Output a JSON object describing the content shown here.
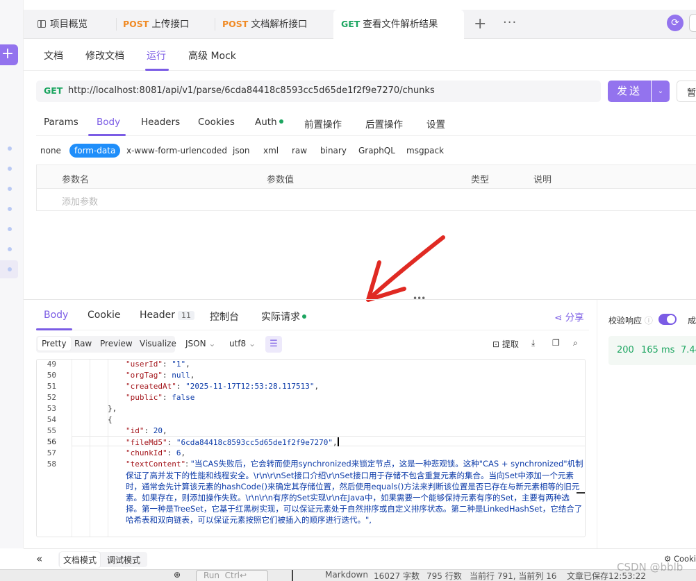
{
  "tabs": {
    "overview": "项目概览",
    "upload": {
      "method": "POST",
      "label": "上传接口"
    },
    "parse": {
      "method": "POST",
      "label": "文档解析接口"
    },
    "result": {
      "method": "GET",
      "label": "查看文件解析结果"
    }
  },
  "subtabs": [
    "文档",
    "修改文档",
    "运行",
    "高级 Mock"
  ],
  "request": {
    "method": "GET",
    "url": "http://localhost:8081/api/v1/parse/6cda84418c8593cc5d65de1f2f9e7270/chunks",
    "send_label": "发送",
    "save_label": "暂"
  },
  "param_tabs": [
    "Params",
    "Body",
    "Headers",
    "Cookies",
    "Auth",
    "前置操作",
    "后置操作",
    "设置"
  ],
  "body_types": [
    "none",
    "form-data",
    "x-www-form-urlencoded",
    "json",
    "xml",
    "raw",
    "binary",
    "GraphQL",
    "msgpack"
  ],
  "param_table": {
    "headers": [
      "参数名",
      "参数值",
      "类型",
      "说明"
    ],
    "add_placeholder": "添加参数"
  },
  "response": {
    "tabs": [
      "Body",
      "Cookie",
      "Header",
      "控制台",
      "实际请求"
    ],
    "header_count": "11",
    "share": "分享",
    "views": [
      "Pretty",
      "Raw",
      "Preview",
      "Visualize"
    ],
    "format": "JSON",
    "encoding": "utf8",
    "extract": "提取",
    "validate_label": "校验响应",
    "validate_cut": "成",
    "status": "200",
    "time": "165 ms",
    "size": "7.44"
  },
  "code": {
    "line_numbers": [
      "49",
      "50",
      "51",
      "52",
      "53",
      "54",
      "55",
      "56",
      "57",
      "58"
    ],
    "l49k": "\"userId\"",
    "l49v": "\"1\"",
    "l50k": "\"orgTag\"",
    "l50v": "null",
    "l51k": "\"createdAt\"",
    "l51v": "\"2025-11-17T12:53:28.117513\"",
    "l52k": "\"public\"",
    "l52v": "false",
    "l53": "},",
    "l54": "{",
    "l55k": "\"id\"",
    "l55v": "20",
    "l56k": "\"fileMd5\"",
    "l56v": "\"6cda84418c8593cc5d65de1f2f9e7270\"",
    "l57k": "\"chunkId\"",
    "l57v": "6",
    "l58k": "\"textContent\"",
    "l58v": "\"当CAS失败后，它会转而使用synchronized来锁定节点，这是一种悲观锁。这种\"CAS + synchronized\"机制保证了高并发下的性能和线程安全。\\r\\n\\r\\nSet接口介绍\\r\\nSet接口用于存储不包含重复元素的集合。当向Set中添加一个元素时，通常会先计算该元素的hashCode()来确定其存储位置，然后使用equals()方法来判断该位置是否已存在与新元素相等的旧元素。如果存在，则添加操作失败。\\r\\n\\r\\n有序的Set实现\\r\\n在Java中，如果需要一个能够保持元素有序的Set，主要有两种选择。第一种是TreeSet，它基于红黑树实现，可以保证元素处于自然排序或自定义排序状态。第二种是LinkedHashSet，它结合了哈希表和双向链表，可以保证元素按照它们被插入的顺序进行迭代。\","
  },
  "bottom": {
    "doc_mode": "文档模式",
    "debug_mode": "调试模式",
    "cookie_cut": "Cooki"
  },
  "osbar": {
    "run": "Run",
    "ctrl": "Ctrl",
    "markdown": "Markdown",
    "chars": "16027 字数",
    "lines": "795 行数",
    "position": "当前行 791, 当前列 16",
    "saved": "文章已保存12:53:22"
  },
  "watermark": "CSDN @bblb"
}
